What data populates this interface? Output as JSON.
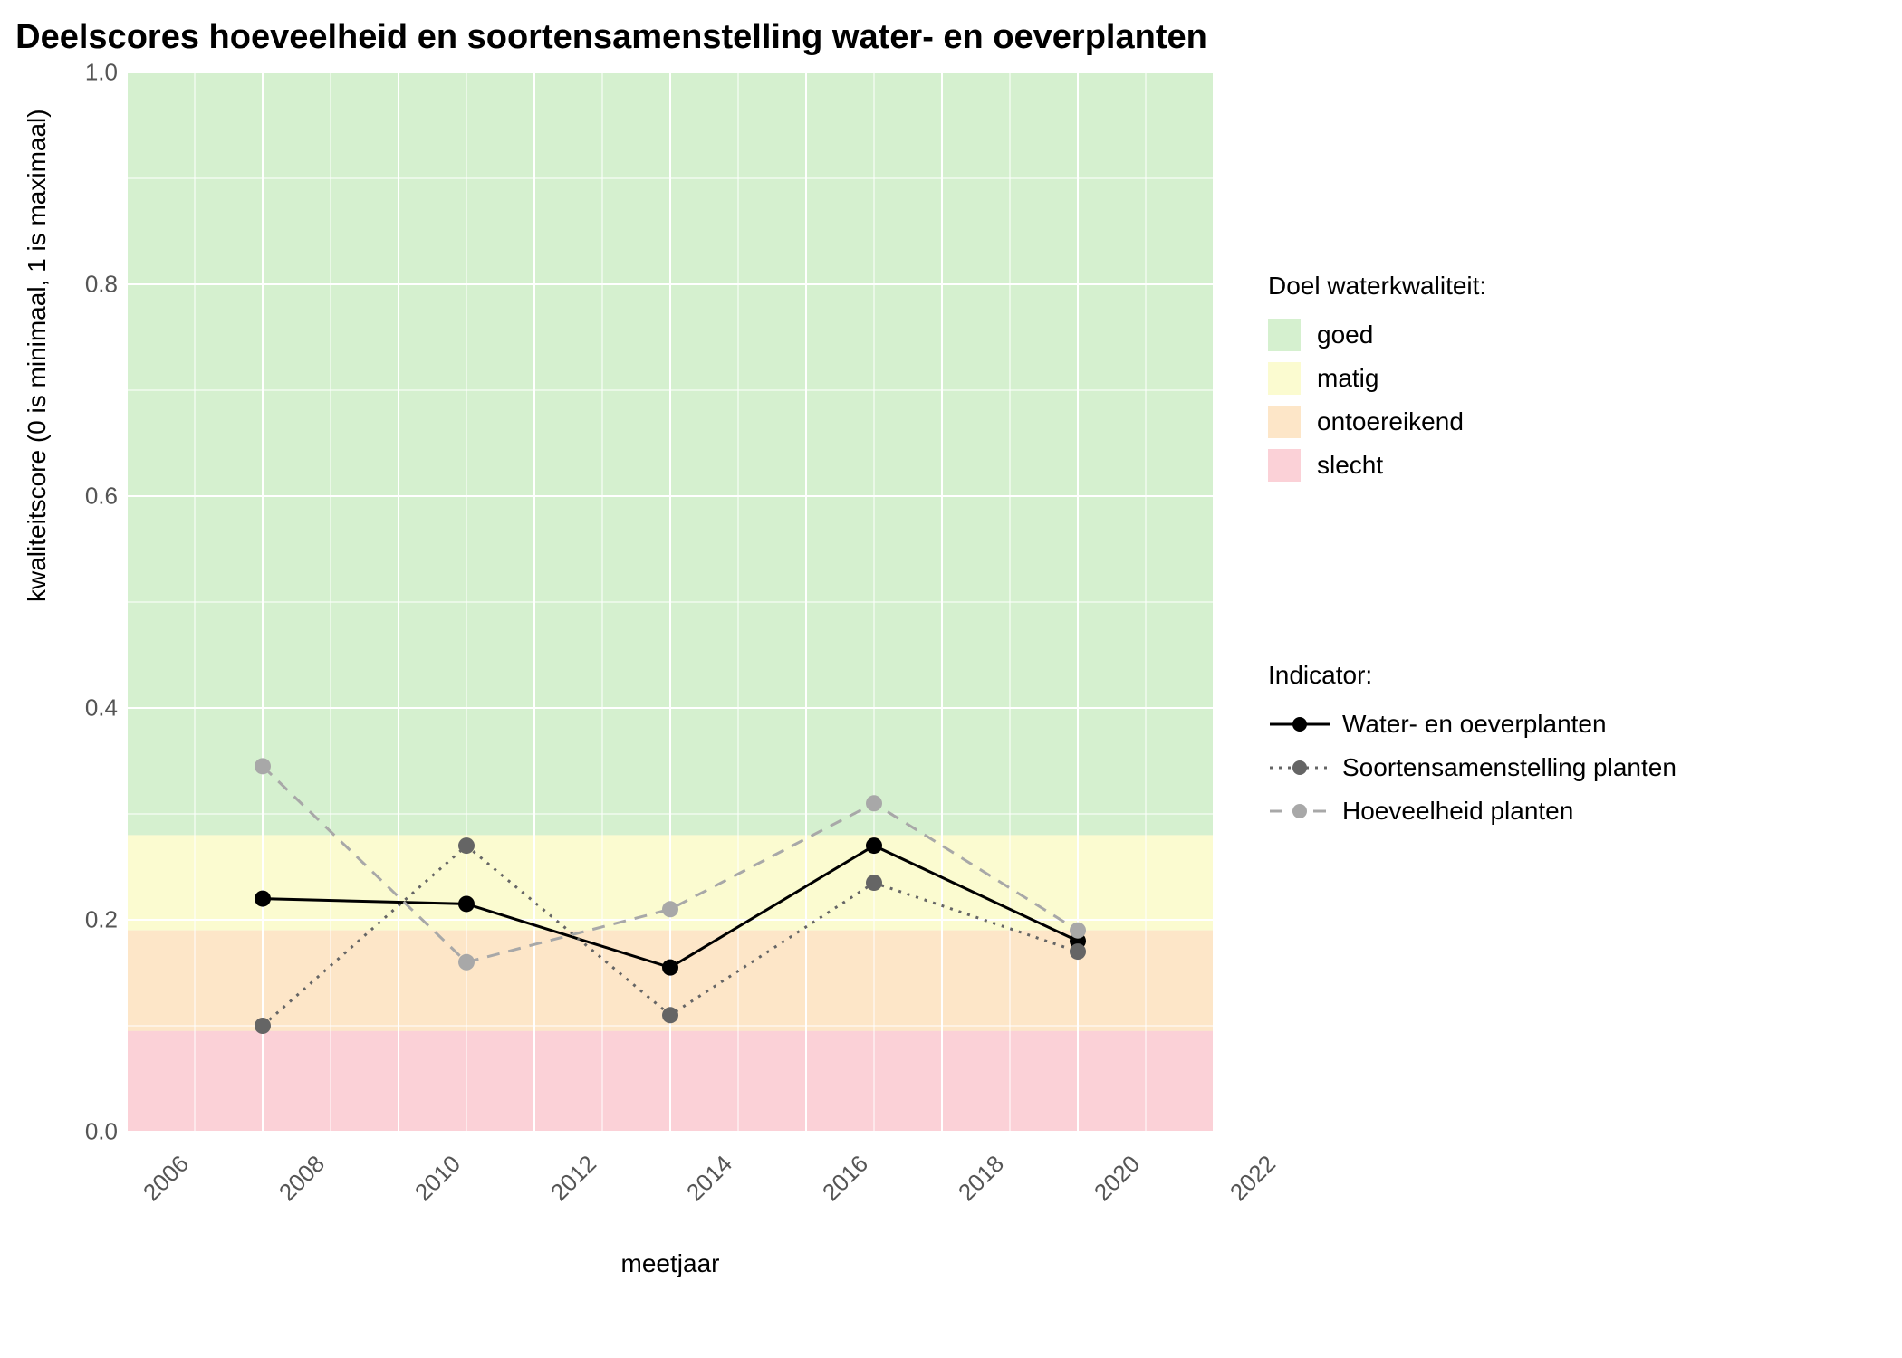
{
  "chart_data": {
    "type": "line",
    "title": "Deelscores hoeveelheid en soortensamenstelling water- en oeverplanten",
    "xlabel": "meetjaar",
    "ylabel": "kwaliteitscore (0 is minimaal, 1 is maximaal)",
    "x_ticks": [
      2006,
      2008,
      2010,
      2012,
      2014,
      2016,
      2018,
      2020,
      2022
    ],
    "y_ticks": [
      0.0,
      0.2,
      0.4,
      0.6,
      0.8,
      1.0
    ],
    "xlim": [
      2006,
      2022
    ],
    "ylim": [
      0.0,
      1.0
    ],
    "background_bands": [
      {
        "name": "goed",
        "ymin": 0.28,
        "ymax": 1.0,
        "color": "#d5f0cf"
      },
      {
        "name": "matig",
        "ymin": 0.19,
        "ymax": 0.28,
        "color": "#fbfbd0"
      },
      {
        "name": "ontoereikend",
        "ymin": 0.095,
        "ymax": 0.19,
        "color": "#fde6c8"
      },
      {
        "name": "slecht",
        "ymin": 0.0,
        "ymax": 0.095,
        "color": "#fbd1d7"
      }
    ],
    "x": [
      2008,
      2011,
      2014,
      2017,
      2020
    ],
    "series": [
      {
        "name": "Water- en oeverplanten",
        "values": [
          0.22,
          0.215,
          0.155,
          0.27,
          0.18
        ],
        "color": "#000000",
        "dash": "solid",
        "marker_color": "#000000"
      },
      {
        "name": "Soortensamenstelling planten",
        "values": [
          0.1,
          0.27,
          0.11,
          0.235,
          0.17
        ],
        "color": "#656565",
        "dash": "dotted",
        "marker_color": "#656565"
      },
      {
        "name": "Hoeveelheid planten",
        "values": [
          0.345,
          0.16,
          0.21,
          0.31,
          0.19
        ],
        "color": "#a8a8a8",
        "dash": "dashed",
        "marker_color": "#a8a8a8"
      }
    ],
    "legend_band_title": "Doel waterkwaliteit:",
    "legend_series_title": "Indicator:",
    "legend_bands": [
      "goed",
      "matig",
      "ontoereikend",
      "slecht"
    ],
    "legend_band_colors": [
      "#d5f0cf",
      "#fbfbd0",
      "#fde6c8",
      "#fbd1d7"
    ]
  }
}
